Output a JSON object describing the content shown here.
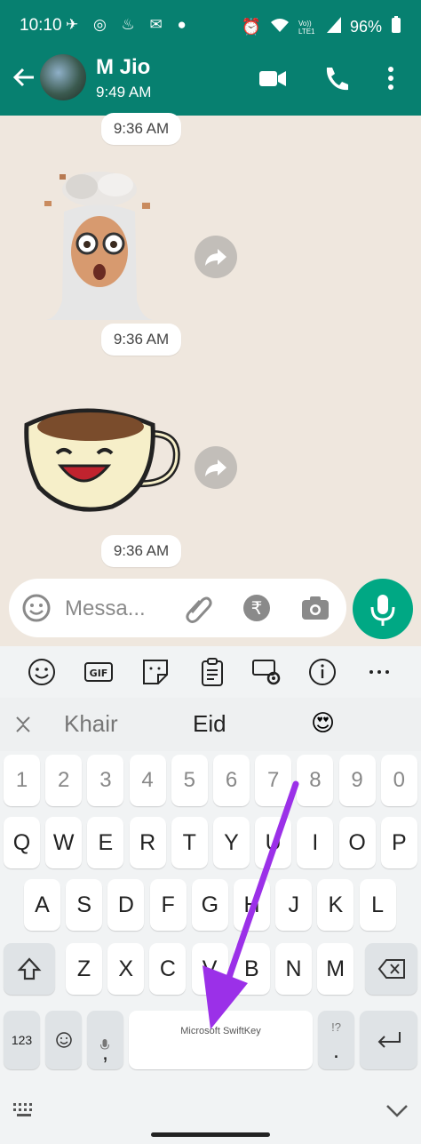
{
  "status_bar": {
    "time": "10:10",
    "battery": "96%",
    "network_label": "Vo)) LTE1"
  },
  "header": {
    "contact_name": "M Jio",
    "contact_status": "9:49 AM"
  },
  "messages": [
    {
      "type": "sticker",
      "sticker": "mind-blown-memoji",
      "time": "9:36 AM"
    },
    {
      "type": "sticker",
      "sticker": "laughing-cup",
      "time": "9:36 AM"
    }
  ],
  "top_timestamp": "9:36 AM",
  "compose": {
    "placeholder": "Messa..."
  },
  "keyboard": {
    "suggestions": [
      "Khair",
      "Eid",
      "😍"
    ],
    "numbers": [
      "1",
      "2",
      "3",
      "4",
      "5",
      "6",
      "7",
      "8",
      "9",
      "0"
    ],
    "row1": [
      "Q",
      "W",
      "E",
      "R",
      "T",
      "Y",
      "U",
      "I",
      "O",
      "P"
    ],
    "row2": [
      "A",
      "S",
      "D",
      "F",
      "G",
      "H",
      "J",
      "K",
      "L"
    ],
    "row3": [
      "Z",
      "X",
      "C",
      "V",
      "B",
      "N",
      "M"
    ],
    "mode_key": "123",
    "comma_key": ",",
    "period_key": ".",
    "space_label": "Microsoft SwiftKey",
    "period_hint": "!?"
  },
  "colors": {
    "header": "#078070",
    "accent": "#00a884",
    "annotation_arrow": "#9b30e8"
  }
}
